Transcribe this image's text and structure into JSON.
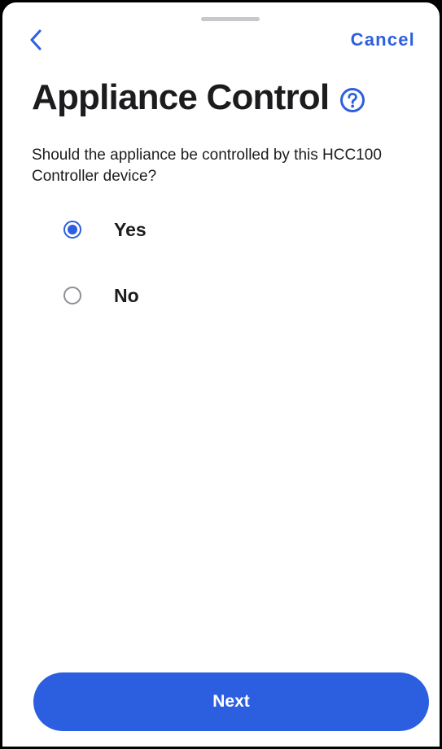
{
  "colors": {
    "accent": "#2c5fe0"
  },
  "header": {
    "back_icon": "chevron-left-icon",
    "cancel_label": "Cancel"
  },
  "title": {
    "text": "Appliance Control",
    "help_icon": "question-circle-icon"
  },
  "prompt": "Should the appliance be controlled by this HCC100 Controller device?",
  "options": [
    {
      "label": "Yes",
      "selected": true
    },
    {
      "label": "No",
      "selected": false
    }
  ],
  "footer": {
    "next_label": "Next"
  }
}
